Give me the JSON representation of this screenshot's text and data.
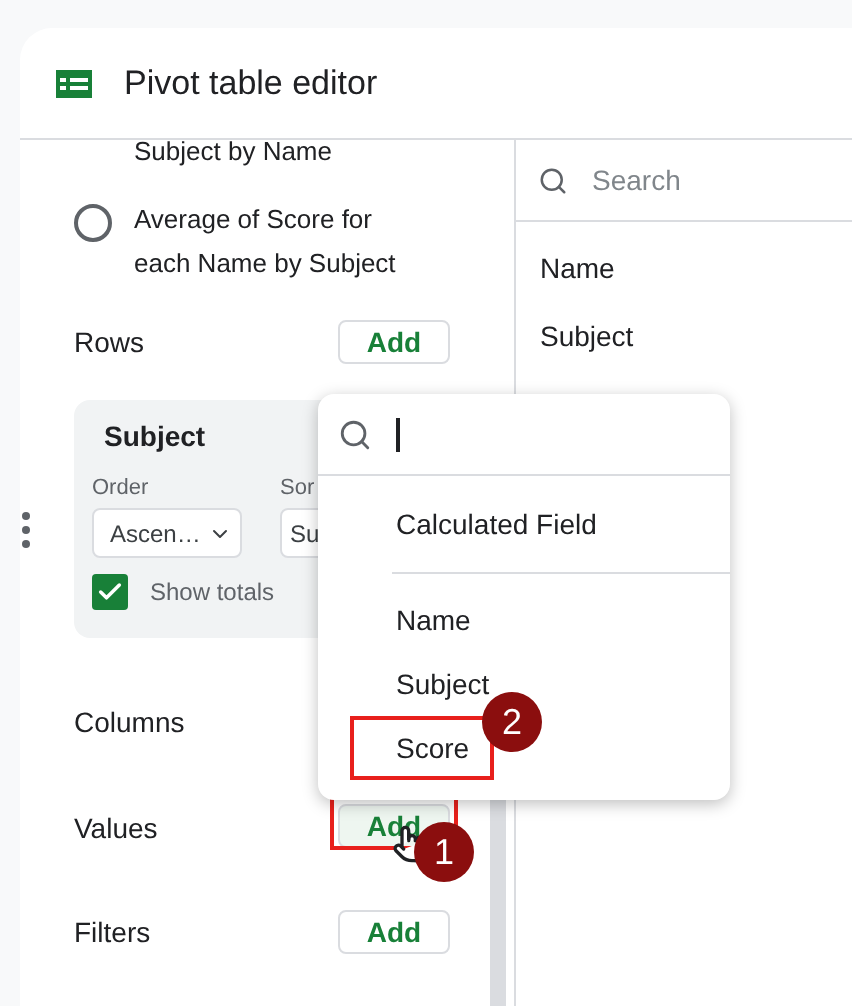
{
  "header": {
    "title": "Pivot table editor"
  },
  "partial_suggestion": "Subject by Name",
  "suggestion": {
    "text": "Average of Score for each Name by Subject",
    "selected": false
  },
  "rows": {
    "label": "Rows",
    "button": "Add",
    "field": {
      "name": "Subject",
      "order_label": "Order",
      "order_value": "Ascen…",
      "sort_label": "Sor",
      "sort_value": "Su",
      "show_totals": {
        "label": "Show totals",
        "checked": true
      }
    }
  },
  "columns": {
    "label": "Columns"
  },
  "values": {
    "label": "Values",
    "button": "Add",
    "highlighted": true
  },
  "filters": {
    "label": "Filters",
    "button": "Add"
  },
  "field_list": {
    "search_placeholder": "Search",
    "items": [
      "Name",
      "Subject"
    ]
  },
  "dropdown": {
    "actions": [
      "Calculated Field"
    ],
    "fields": [
      {
        "text": "Name",
        "highlighted": false
      },
      {
        "text": "Subject",
        "highlighted": false
      },
      {
        "text": "Score",
        "highlighted": true
      }
    ]
  },
  "callouts": [
    "1",
    "2"
  ]
}
